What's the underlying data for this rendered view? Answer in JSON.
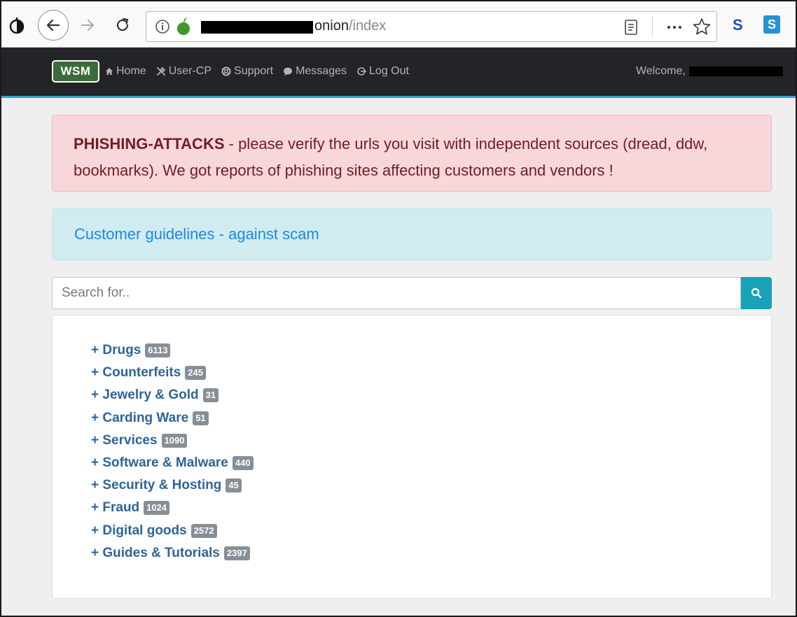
{
  "browser": {
    "url_host": "onion",
    "url_path": "/index",
    "extensions": [
      "S",
      "S"
    ]
  },
  "navbar": {
    "logo": "WSM",
    "links": [
      {
        "icon": "home-icon",
        "label": "Home"
      },
      {
        "icon": "tools-icon",
        "label": "User-CP"
      },
      {
        "icon": "lifebuoy-icon",
        "label": "Support"
      },
      {
        "icon": "message-icon",
        "label": "Messages"
      },
      {
        "icon": "logout-icon",
        "label": "Log Out"
      }
    ],
    "welcome": "Welcome,"
  },
  "alerts": {
    "phishing_title": "PHISHING-ATTACKS",
    "phishing_text": " - please verify the urls you visit with independent sources (dread, ddw, bookmarks). We got reports of phishing sites affecting customers and vendors !",
    "guidelines_link": "Customer guidelines - against scam"
  },
  "search": {
    "placeholder": "Search for..",
    "value": ""
  },
  "categories": [
    {
      "label": "+ Drugs",
      "count": "6113"
    },
    {
      "label": "+ Counterfeits",
      "count": "245"
    },
    {
      "label": "+ Jewelry & Gold",
      "count": "31"
    },
    {
      "label": "+ Carding Ware",
      "count": "51"
    },
    {
      "label": "+ Services",
      "count": "1090"
    },
    {
      "label": "+ Software & Malware",
      "count": "440"
    },
    {
      "label": "+ Security & Hosting",
      "count": "45"
    },
    {
      "label": "+ Fraud",
      "count": "1024"
    },
    {
      "label": "+ Digital goods",
      "count": "2572"
    },
    {
      "label": "+ Guides & Tutorials",
      "count": "2397"
    }
  ],
  "colors": {
    "navbar_bg": "#222427",
    "accent": "#2aa4d8",
    "danger_bg": "#f8d7da",
    "info_bg": "#d1ecf1",
    "search_btn": "#17a2b8",
    "category_link": "#2e6499",
    "badge": "#868e96"
  }
}
